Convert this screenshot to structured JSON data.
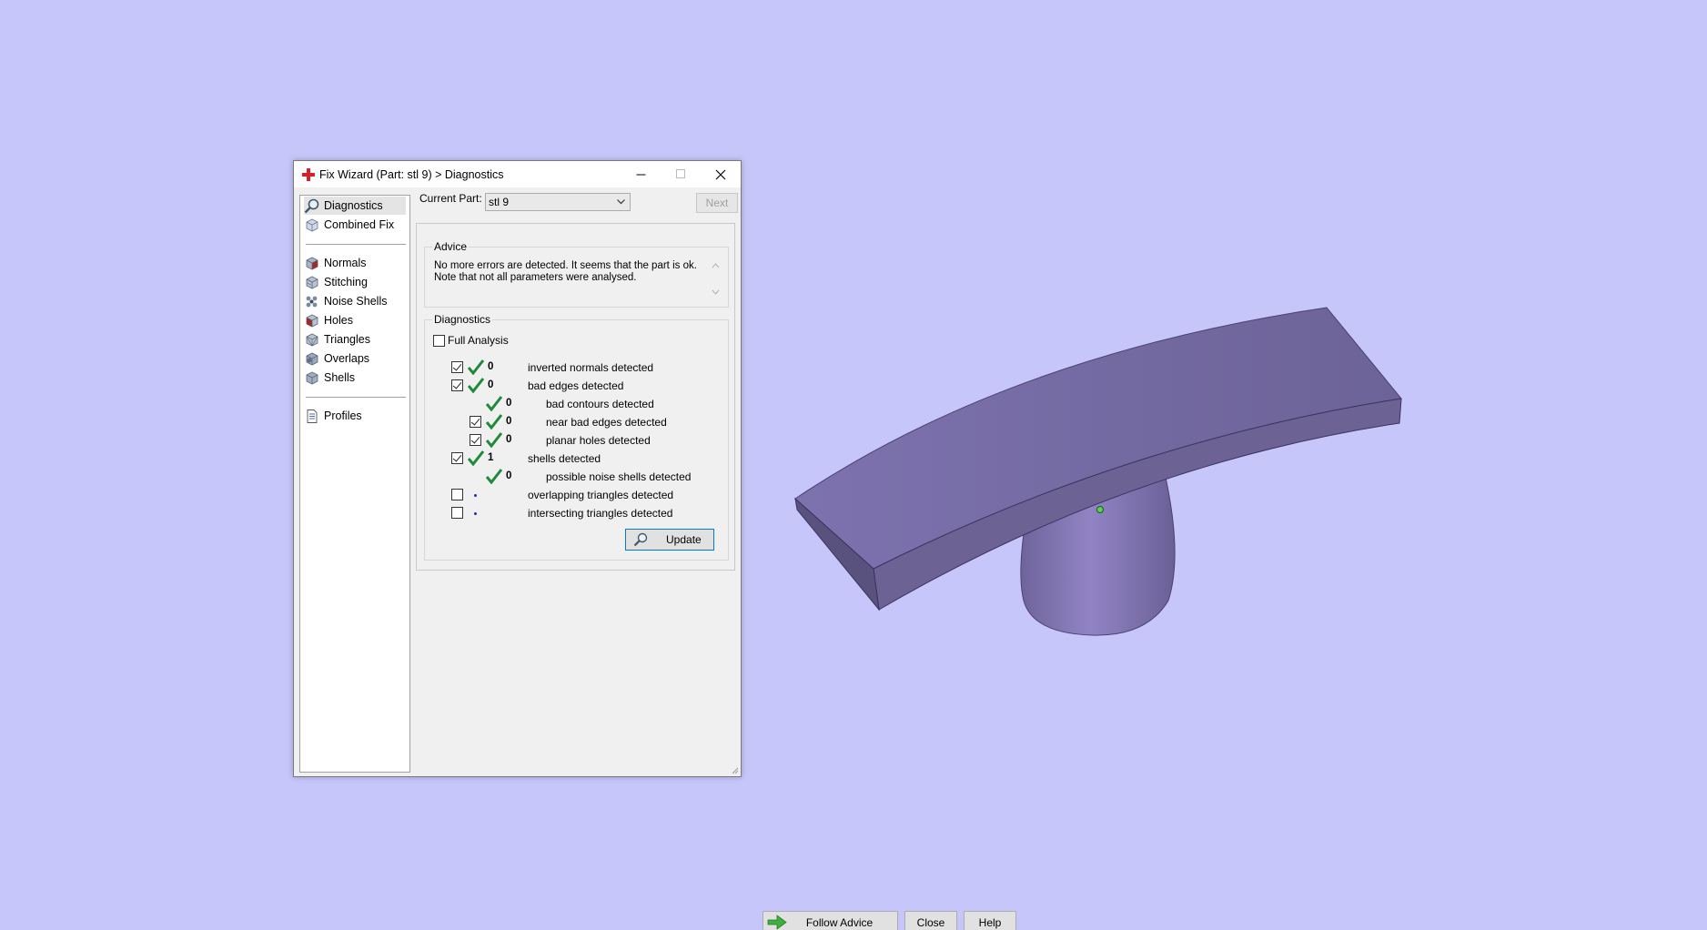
{
  "window": {
    "title": "Fix Wizard (Part: stl 9) > Diagnostics",
    "icon": "red-cross-icon"
  },
  "sidebar": {
    "items": [
      {
        "label": "Diagnostics",
        "icon": "magnifier-icon",
        "selected": true
      },
      {
        "label": "Combined Fix",
        "icon": "cube-icon"
      },
      {
        "label": "Normals",
        "icon": "normals-cube-icon"
      },
      {
        "label": "Stitching",
        "icon": "stitching-cube-icon"
      },
      {
        "label": "Noise Shells",
        "icon": "noise-shells-icon"
      },
      {
        "label": "Holes",
        "icon": "holes-cube-icon"
      },
      {
        "label": "Triangles",
        "icon": "triangles-cube-icon"
      },
      {
        "label": "Overlaps",
        "icon": "overlaps-cube-icon"
      },
      {
        "label": "Shells",
        "icon": "shells-cube-icon"
      },
      {
        "label": "Profiles",
        "icon": "document-icon"
      }
    ]
  },
  "current_part": {
    "label": "Current Part:",
    "value": "stl 9"
  },
  "next_button": "Next",
  "advice": {
    "group_label": "Advice",
    "line1": "No more errors are detected. It seems that the part is ok.",
    "line2": "Note that not all parameters were analysed."
  },
  "diagnostics": {
    "group_label": "Diagnostics",
    "full_analysis_label": "Full Analysis",
    "full_analysis_checked": false,
    "rows": [
      {
        "checkbox": true,
        "checked": true,
        "status": "ok",
        "count": "0",
        "label": "inverted normals detected"
      },
      {
        "checkbox": true,
        "checked": true,
        "status": "ok",
        "count": "0",
        "label": "bad edges detected"
      },
      {
        "checkbox": false,
        "status": "ok",
        "count": "0",
        "label": "bad contours detected"
      },
      {
        "checkbox": true,
        "checked": true,
        "status": "ok",
        "count": "0",
        "label": "near bad edges detected"
      },
      {
        "checkbox": true,
        "checked": true,
        "status": "ok",
        "count": "0",
        "label": "planar holes detected"
      },
      {
        "checkbox": true,
        "checked": true,
        "status": "ok",
        "count": "1",
        "label": "shells detected"
      },
      {
        "checkbox": false,
        "status": "ok",
        "count": "0",
        "label": "possible noise shells detected"
      },
      {
        "checkbox": true,
        "checked": false,
        "status": "pending",
        "count": "",
        "label": "overlapping triangles detected"
      },
      {
        "checkbox": true,
        "checked": false,
        "status": "pending",
        "count": "",
        "label": "intersecting triangles detected"
      }
    ],
    "update_label": "Update"
  },
  "buttons": {
    "follow_advice": "Follow Advice",
    "close": "Close",
    "help": "Help"
  },
  "colors": {
    "background": "#c6c6fb",
    "model": "#7a6ea8",
    "check_green": "#1f8a3a",
    "focus_blue": "#0078d7"
  }
}
